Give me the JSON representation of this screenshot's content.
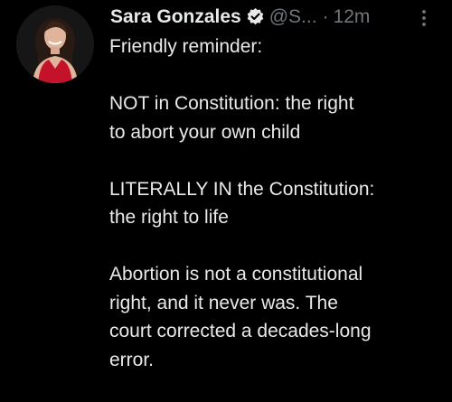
{
  "tweet": {
    "author_name": "Sara Gonzales",
    "handle": "@S...",
    "separator": "·",
    "timestamp": "12m",
    "verified": true,
    "verified_color": "#e7e9ea",
    "more_icon": "more-vertical-icon",
    "avatar_icon": "avatar-photo",
    "paragraphs": [
      {
        "lines": [
          "Friendly reminder:"
        ]
      },
      {
        "lines": [
          "NOT in Constitution: the right",
          "to abort your own child"
        ]
      },
      {
        "lines": [
          "LITERALLY IN the Constitution:",
          "the right to life"
        ]
      },
      {
        "lines": [
          "Abortion is not a constitutional",
          "right, and it never was. The",
          "court corrected a decades-long",
          "error."
        ]
      }
    ]
  },
  "colors": {
    "background": "#000000",
    "text": "#e7e9ea",
    "secondary": "#71767b",
    "avatar_dress": "#c4122b"
  }
}
